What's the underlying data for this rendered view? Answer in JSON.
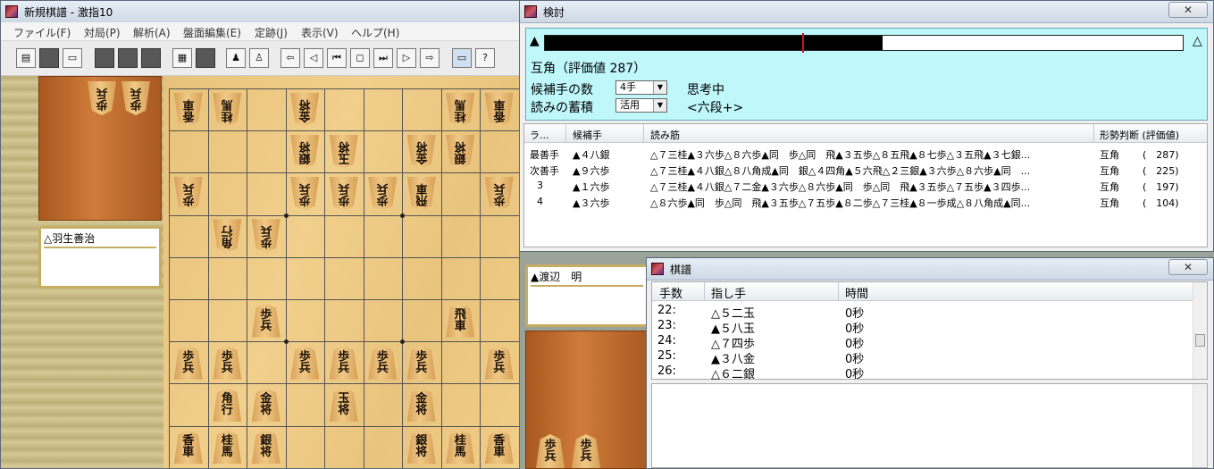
{
  "main_window": {
    "title": "新規棋譜 - 激指10",
    "menu": [
      "ファイル(F)",
      "対局(P)",
      "解析(A)",
      "盤面編集(E)",
      "定跡(J)",
      "表示(V)",
      "ヘルプ(H)"
    ],
    "gote_player": "△羽生善治",
    "gote_hand": [
      {
        "label": "歩",
        "promoted_side": "",
        "dir": "down"
      },
      {
        "label": "歩",
        "dir": "down"
      }
    ]
  },
  "board": {
    "rows": [
      [
        "香車d",
        "桂馬d",
        "",
        "金将d",
        "",
        "",
        "",
        "桂馬d",
        "香車d"
      ],
      [
        "",
        "",
        "",
        "銀将d",
        "玉将d",
        "",
        "金将d",
        "銀将d",
        ""
      ],
      [
        "歩兵d",
        "",
        "",
        "歩兵d",
        "歩兵d",
        "歩兵d",
        "飛車d",
        "",
        "歩兵d"
      ],
      [
        "",
        "角行d",
        "歩兵d",
        "",
        "",
        "",
        "",
        "",
        ""
      ],
      [
        "",
        "",
        "",
        "",
        "",
        "",
        "",
        "",
        ""
      ],
      [
        "",
        "",
        "歩兵u",
        "",
        "",
        "",
        "",
        "飛車u",
        ""
      ],
      [
        "歩兵u",
        "歩兵u",
        "",
        "歩兵u",
        "歩兵u",
        "歩兵u",
        "歩兵u",
        "",
        "歩兵u"
      ],
      [
        "",
        "角行u",
        "金将u",
        "",
        "玉将u",
        "",
        "金将u",
        "",
        ""
      ],
      [
        "香車u",
        "桂馬u",
        "銀将u",
        "",
        "",
        "",
        "銀将u",
        "桂馬u",
        "香車u"
      ]
    ]
  },
  "analysis": {
    "title": "検討",
    "close": "✕",
    "sente_mark": "▲",
    "gote_mark": "△",
    "eval_fraction": 0.53,
    "status_line": "互角（評価値 287）",
    "candidates_label": "候補手の数",
    "candidates_value": "4手",
    "stock_label": "読みの蓄積",
    "stock_value": "活用",
    "thinking": "思考中",
    "level": "<六段+>",
    "columns": [
      "ラ...",
      "候補手",
      "読み筋",
      "形勢判断 (評価値)"
    ],
    "rows": [
      {
        "rank": "最善手",
        "move": "▲４八銀",
        "pv": "△７三桂▲３六歩△８六歩▲同　歩△同　飛▲３五歩△８五飛▲８七歩△３五飛▲３七銀...",
        "judge": "互角",
        "value": "(　287)"
      },
      {
        "rank": "次善手",
        "move": "▲９六歩",
        "pv": "△７三桂▲４八銀△８八角成▲同　銀△４四角▲５六飛△２三銀▲３六歩△８六歩▲同　...",
        "judge": "互角",
        "value": "(　225)"
      },
      {
        "rank": "3",
        "move": "▲１六歩",
        "pv": "△７三桂▲４八銀△７二金▲３六歩△８六歩▲同　歩△同　飛▲３五歩△７五歩▲３四歩...",
        "judge": "互角",
        "value": "(　197)"
      },
      {
        "rank": "4",
        "move": "▲３六歩",
        "pv": "△８六歩▲同　歩△同　飛▲３五歩△７五歩▲８二歩△７三桂▲８一歩成△８八角成▲同...",
        "judge": "互角",
        "value": "(　104)"
      }
    ]
  },
  "sente_player": "▲渡辺　明",
  "kifu": {
    "title": "棋譜",
    "close": "✕",
    "columns": [
      "手数",
      "指し手",
      "時間"
    ],
    "rows": [
      {
        "no": "22:",
        "move": "△５二玉",
        "time": "0秒"
      },
      {
        "no": "23:",
        "move": "▲５八玉",
        "time": "0秒"
      },
      {
        "no": "24:",
        "move": "△７四歩",
        "time": "0秒"
      },
      {
        "no": "25:",
        "move": "▲３八金",
        "time": "0秒"
      },
      {
        "no": "26:",
        "move": "△６二銀",
        "time": "0秒"
      }
    ]
  },
  "sente_hand": [
    {
      "label": "歩兵"
    },
    {
      "label": "歩兵"
    }
  ]
}
